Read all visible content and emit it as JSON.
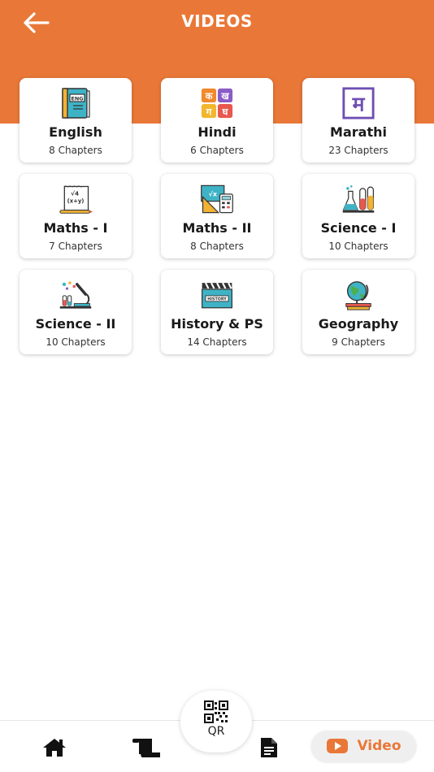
{
  "header": {
    "title": "VIDEOS",
    "back_icon": "arrow-left-icon",
    "color": "#E97838"
  },
  "subjects": [
    {
      "name": "English",
      "chapters": "8 Chapters",
      "icon": "english-book-icon"
    },
    {
      "name": "Hindi",
      "chapters": "6 Chapters",
      "icon": "hindi-letters-icon"
    },
    {
      "name": "Marathi",
      "chapters": "23 Chapters",
      "icon": "marathi-letter-icon"
    },
    {
      "name": "Maths - I",
      "chapters": "7 Chapters",
      "icon": "math-notebook-icon"
    },
    {
      "name": "Maths - II",
      "chapters": "8 Chapters",
      "icon": "math-tools-icon"
    },
    {
      "name": "Science - I",
      "chapters": "10 Chapters",
      "icon": "lab-flasks-icon"
    },
    {
      "name": "Science - II",
      "chapters": "10 Chapters",
      "icon": "microscope-icon"
    },
    {
      "name": "History & PS",
      "chapters": "14 Chapters",
      "icon": "clapperboard-icon"
    },
    {
      "name": "Geography",
      "chapters": "9 Chapters",
      "icon": "globe-icon"
    }
  ],
  "icon_text": {
    "english_badge": "ENG",
    "hindi_letters": [
      "क",
      "ख",
      "ग",
      "घ"
    ],
    "marathi_letter": "म",
    "history_badge": "HISTORY"
  },
  "bottom_nav": {
    "home_icon": "home-icon",
    "notes_icon": "scroll-icon",
    "qr_label": "QR",
    "doc_icon": "document-icon",
    "video_label": "Video",
    "video_icon": "youtube-icon"
  }
}
